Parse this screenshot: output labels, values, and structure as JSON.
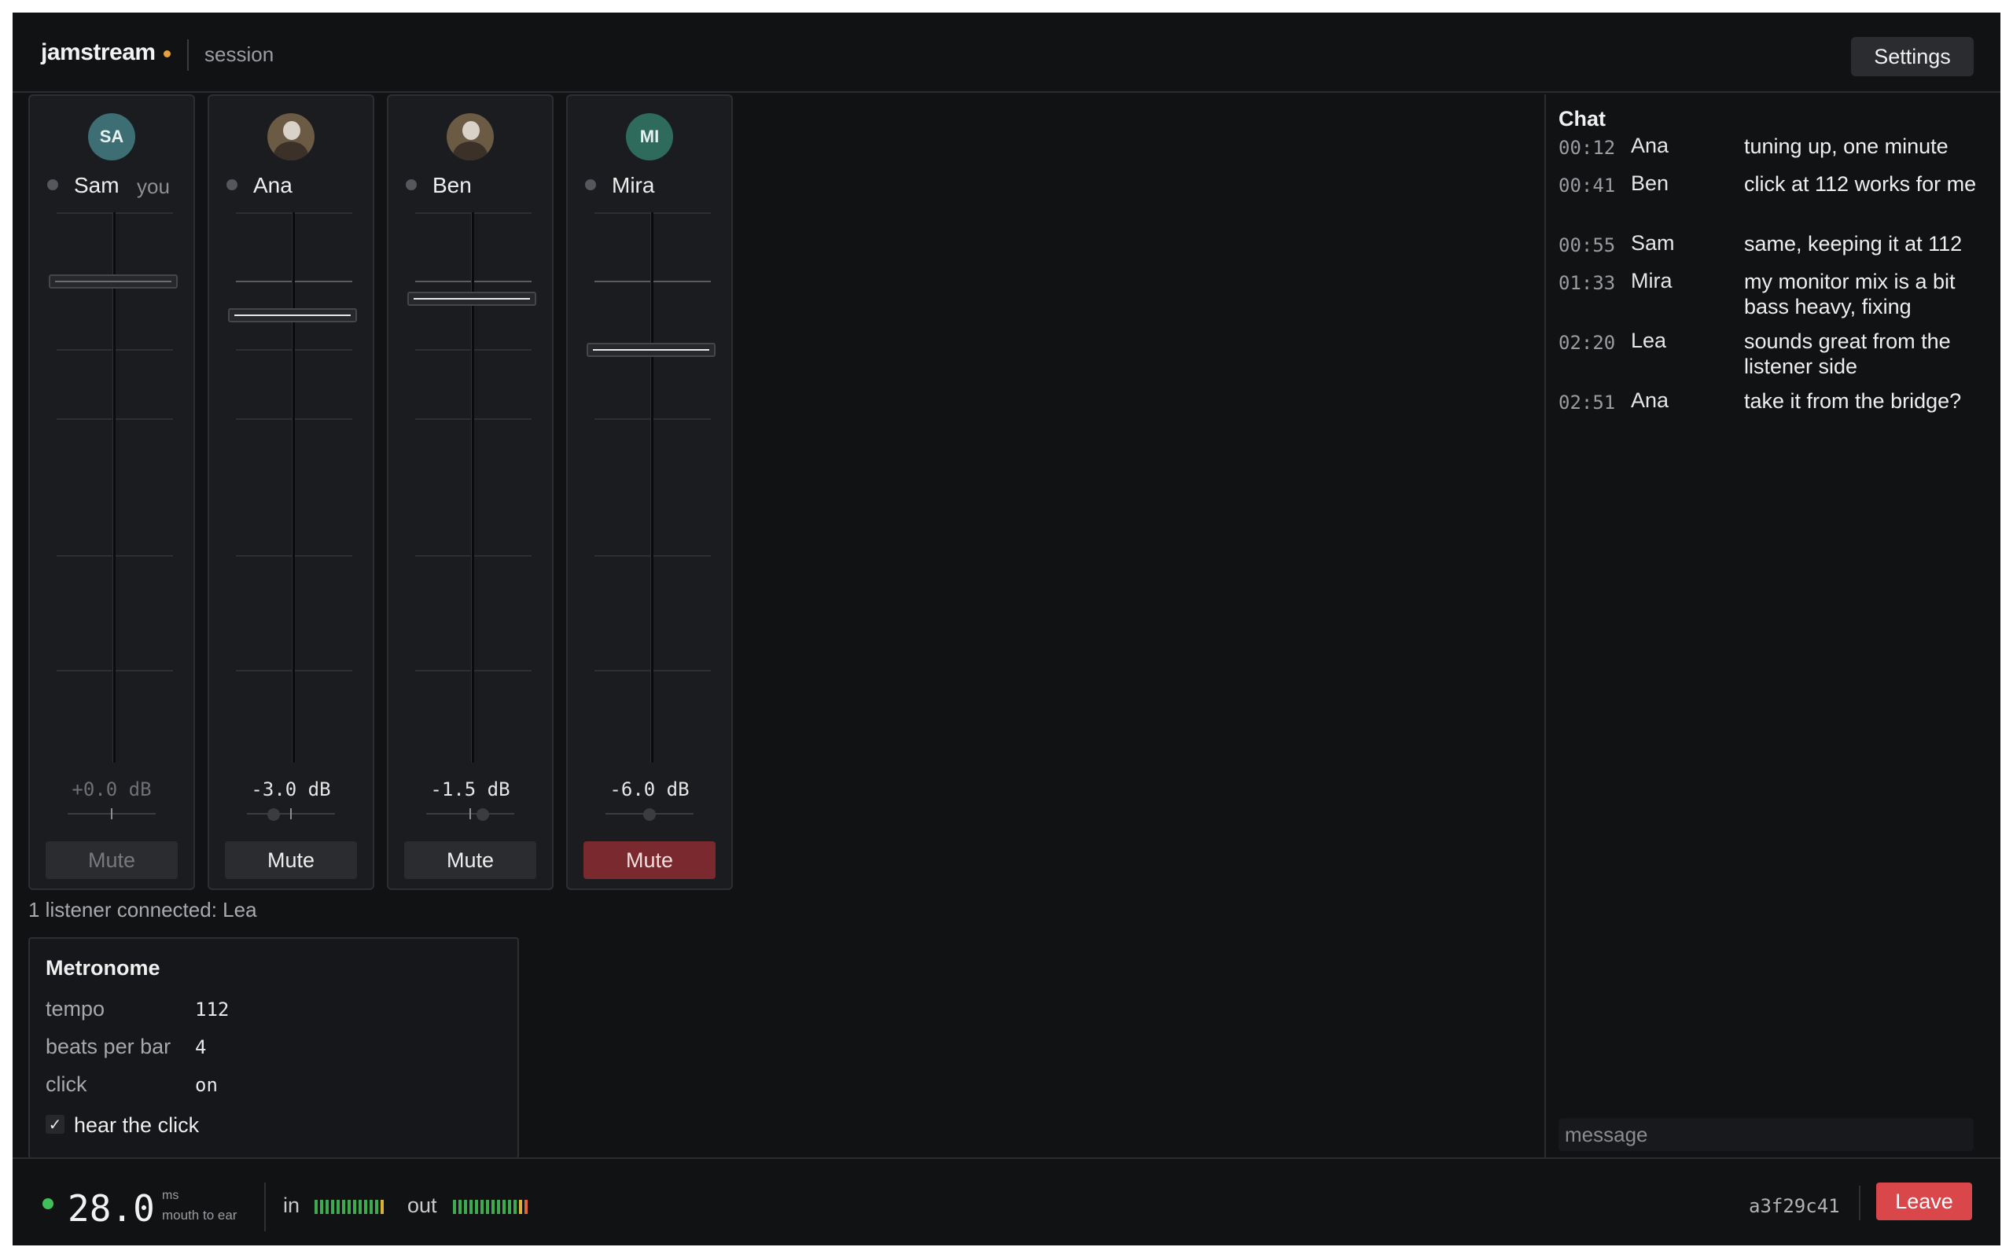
{
  "header": {
    "brand": "jamstream",
    "subtitle": "session",
    "settings_label": "Settings",
    "brand_dot_color": "#e8a13a"
  },
  "channels": [
    {
      "initials": "SA",
      "name": "Sam",
      "you_label": "you",
      "gain": "+0.0 dB",
      "mute_label": "Mute",
      "muted": false,
      "avatar": "initials",
      "avatar_color": "#3d6e73",
      "self": true
    },
    {
      "initials": "",
      "name": "Ana",
      "gain": "-3.0 dB",
      "mute_label": "Mute",
      "muted": false,
      "avatar": "photo-icon"
    },
    {
      "initials": "",
      "name": "Ben",
      "gain": "-1.5 dB",
      "mute_label": "Mute",
      "muted": false,
      "avatar": "photo-icon"
    },
    {
      "initials": "MI",
      "name": "Mira",
      "gain": "-6.0 dB",
      "mute_label": "Mute",
      "muted": true,
      "avatar": "initials",
      "avatar_color": "#2f6b5c"
    }
  ],
  "listener_text": "1 listener connected: Lea",
  "metronome": {
    "title": "Metronome",
    "rows": [
      {
        "label": "tempo",
        "value": "112"
      },
      {
        "label": "beats per bar",
        "value": "4"
      },
      {
        "label": "click",
        "value": "on"
      }
    ],
    "checkbox_label": "hear the click",
    "checkbox_checked": true,
    "checkbox_mark": "✓"
  },
  "chat": {
    "title": "Chat",
    "messages": [
      {
        "time": "00:12",
        "author": "Ana",
        "text": "tuning up, one minute"
      },
      {
        "time": "00:41",
        "author": "Ben",
        "text": "click at 112 works for me"
      },
      {
        "time": "00:55",
        "author": "Sam",
        "text": "same, keeping it at 112"
      },
      {
        "time": "01:33",
        "author": "Mira",
        "text": "my monitor mix is a bit bass heavy, fixing"
      },
      {
        "time": "02:20",
        "author": "Lea",
        "text": "sounds great from the listener side"
      },
      {
        "time": "02:51",
        "author": "Ana",
        "text": "take it from the bridge?"
      }
    ],
    "input_placeholder": "message"
  },
  "footer": {
    "latency": "28.0",
    "latency_unit": "ms",
    "latency_caption": "mouth to ear",
    "status_color": "#3fbf5a",
    "in_label": "in",
    "out_label": "out",
    "session_id": "a3f29c41",
    "leave_label": "Leave",
    "leave_color": "#d9474b"
  }
}
